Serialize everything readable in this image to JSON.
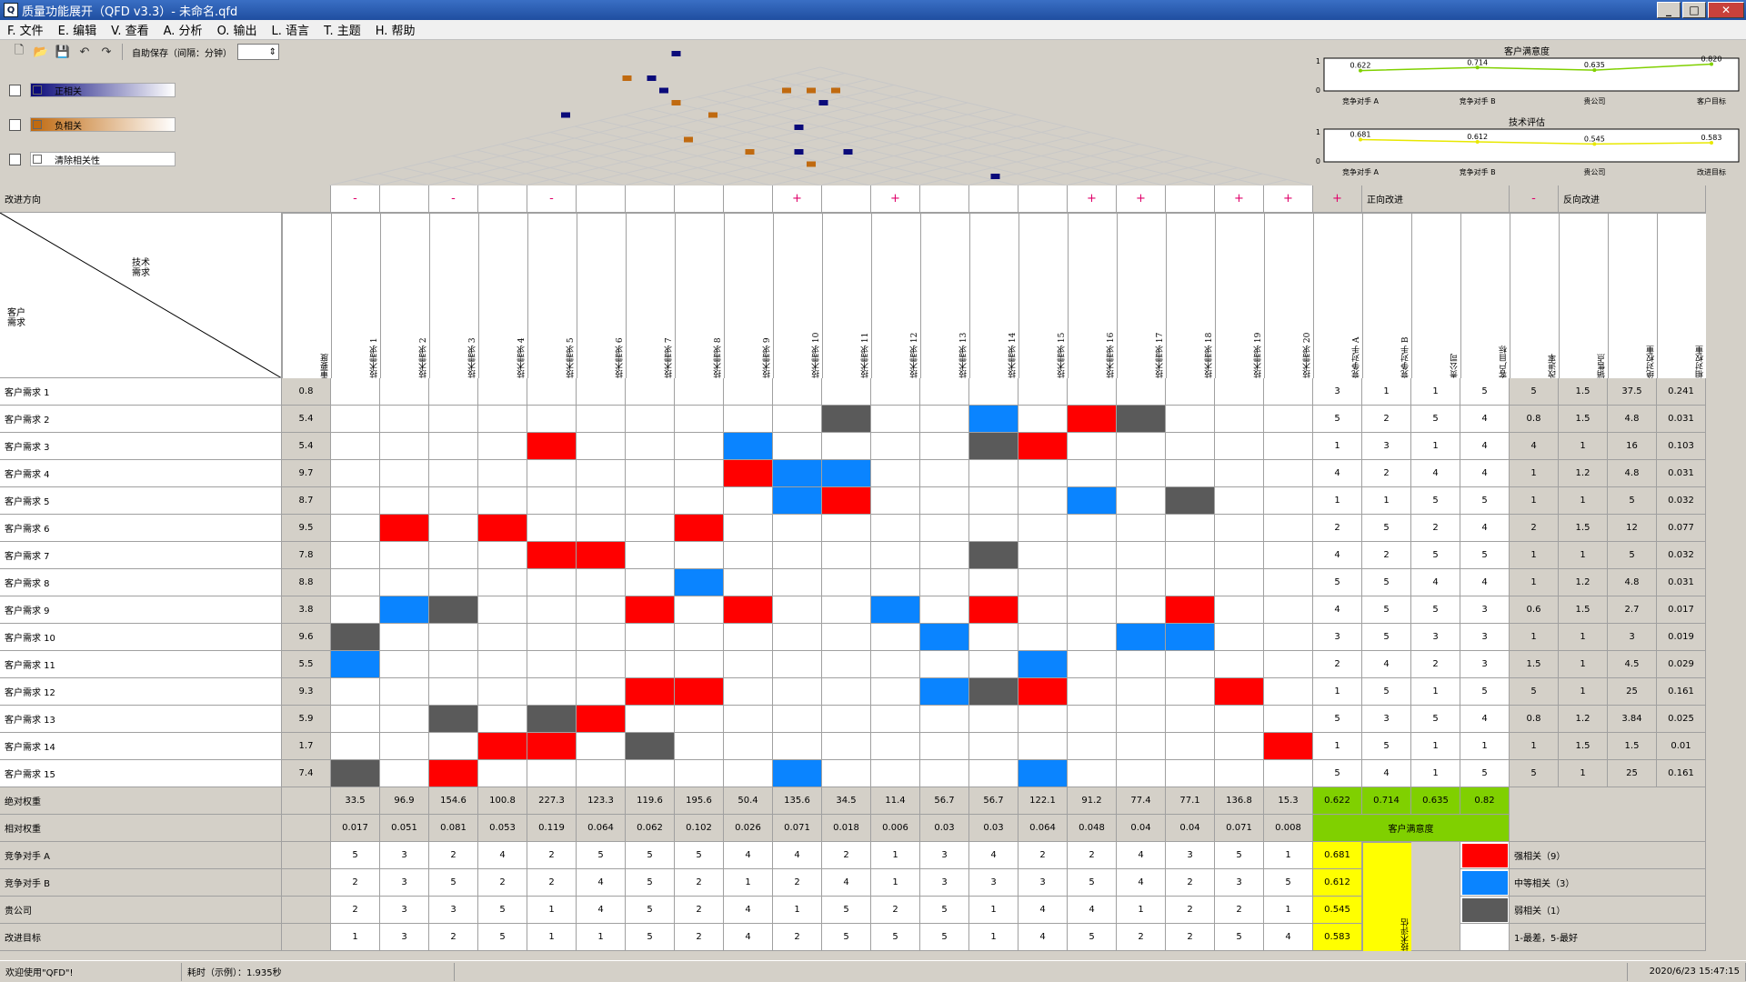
{
  "window": {
    "title": "质量功能展开（QFD  v3.3）- 未命名.qfd",
    "icon_glyph": "Q"
  },
  "menu": [
    "F. 文件",
    "E. 编辑",
    "V. 查看",
    "A. 分析",
    "O. 输出",
    "L. 语言",
    "T. 主题",
    "H. 帮助"
  ],
  "toolbar": {
    "autosave_label": "自助保存（间隔：分钟）",
    "autosave_value": ""
  },
  "legend_top": [
    {
      "label": "正相关",
      "color": "#0a0a7a"
    },
    {
      "label": "负相关",
      "color": "#c06a10"
    },
    {
      "label": "清除相关性",
      "color": "#ffffff"
    }
  ],
  "charts": {
    "customer": {
      "title": "客户满意度",
      "categories": [
        "竞争对手 A",
        "竞争对手 B",
        "贵公司",
        "客户目标"
      ],
      "values": [
        0.622,
        0.714,
        0.635,
        0.82
      ],
      "value_labels": [
        "0.622",
        "0.714",
        "0.635",
        "0.820"
      ],
      "ylim": [
        0,
        1
      ],
      "color": "#80d000",
      "ytick_max": "1",
      "ytick_min": "0"
    },
    "tech": {
      "title": "技术评估",
      "categories": [
        "竞争对手 A",
        "竞争对手 B",
        "贵公司",
        "改进目标"
      ],
      "values": [
        0.681,
        0.612,
        0.545,
        0.583
      ],
      "value_labels": [
        "0.681",
        "0.612",
        "0.545",
        "0.583"
      ],
      "ylim": [
        0,
        1
      ],
      "color": "#e8e800",
      "ytick_max": "1",
      "ytick_min": "0"
    }
  },
  "headers": {
    "improve_dir": "改进方向",
    "tech_req": "技术需求",
    "cust_req": "客户需求",
    "importance": "重要度",
    "pos_improve": "正向改进",
    "neg_improve": "反向改进",
    "abs_weight": "绝对权重",
    "rel_weight": "相对权重",
    "comp_a": "竞争对手 A",
    "comp_b": "竞争对手 B",
    "own": "贵公司",
    "target": "改进目标",
    "cust_sat": "客户满意度",
    "tech_eval": "技术评估",
    "right_cols": [
      "竞争对手 A",
      "竞争对手 B",
      "贵公司",
      "客户目标",
      "改进率",
      "销售点",
      "绝对权重",
      "相对权重"
    ]
  },
  "tech_labels": [
    "技术需求 1",
    "技术需求 2",
    "技术需求 3",
    "技术需求 4",
    "技术需求 5",
    "技术需求 6",
    "技术需求 7",
    "技术需求 8",
    "技术需求 9",
    "技术需求 10",
    "技术需求 11",
    "技术需求 12",
    "技术需求 13",
    "技术需求 14",
    "技术需求 15",
    "技术需求 16",
    "技术需求 17",
    "技术需求 18",
    "技术需求 19",
    "技术需求 20"
  ],
  "directions": [
    "-",
    "",
    "-",
    "",
    "-",
    "",
    "",
    "",
    "",
    "+",
    "",
    "+",
    "",
    "",
    "",
    "+",
    "+",
    "",
    "+",
    "+"
  ],
  "rows": [
    {
      "label": "客户需求 1",
      "imp": "0.8",
      "r": [
        "3",
        "1",
        "1",
        "5",
        "5",
        "1.5",
        "37.5",
        "0.241"
      ]
    },
    {
      "label": "客户需求 2",
      "imp": "5.4",
      "r": [
        "5",
        "2",
        "5",
        "4",
        "0.8",
        "1.5",
        "4.8",
        "0.031"
      ]
    },
    {
      "label": "客户需求 3",
      "imp": "5.4",
      "r": [
        "1",
        "3",
        "1",
        "4",
        "4",
        "1",
        "16",
        "0.103"
      ]
    },
    {
      "label": "客户需求 4",
      "imp": "9.7",
      "r": [
        "4",
        "2",
        "4",
        "4",
        "1",
        "1.2",
        "4.8",
        "0.031"
      ]
    },
    {
      "label": "客户需求 5",
      "imp": "8.7",
      "r": [
        "1",
        "1",
        "5",
        "5",
        "1",
        "1",
        "5",
        "0.032"
      ]
    },
    {
      "label": "客户需求 6",
      "imp": "9.5",
      "r": [
        "2",
        "5",
        "2",
        "4",
        "2",
        "1.5",
        "12",
        "0.077"
      ]
    },
    {
      "label": "客户需求 7",
      "imp": "7.8",
      "r": [
        "4",
        "2",
        "5",
        "5",
        "1",
        "1",
        "5",
        "0.032"
      ]
    },
    {
      "label": "客户需求 8",
      "imp": "8.8",
      "r": [
        "5",
        "5",
        "4",
        "4",
        "1",
        "1.2",
        "4.8",
        "0.031"
      ]
    },
    {
      "label": "客户需求 9",
      "imp": "3.8",
      "r": [
        "4",
        "5",
        "5",
        "3",
        "0.6",
        "1.5",
        "2.7",
        "0.017"
      ]
    },
    {
      "label": "客户需求 10",
      "imp": "9.6",
      "r": [
        "3",
        "5",
        "3",
        "3",
        "1",
        "1",
        "3",
        "0.019"
      ]
    },
    {
      "label": "客户需求 11",
      "imp": "5.5",
      "r": [
        "2",
        "4",
        "2",
        "3",
        "1.5",
        "1",
        "4.5",
        "0.029"
      ]
    },
    {
      "label": "客户需求 12",
      "imp": "9.3",
      "r": [
        "1",
        "5",
        "1",
        "5",
        "5",
        "1",
        "25",
        "0.161"
      ]
    },
    {
      "label": "客户需求 13",
      "imp": "5.9",
      "r": [
        "5",
        "3",
        "5",
        "4",
        "0.8",
        "1.2",
        "3.84",
        "0.025"
      ]
    },
    {
      "label": "客户需求 14",
      "imp": "1.7",
      "r": [
        "1",
        "5",
        "1",
        "1",
        "1",
        "1.5",
        "1.5",
        "0.01"
      ]
    },
    {
      "label": "客户需求 15",
      "imp": "7.4",
      "r": [
        "5",
        "4",
        "1",
        "5",
        "5",
        "1",
        "25",
        "0.161"
      ]
    }
  ],
  "matrix": {
    "strong": [
      [
        1,
        15
      ],
      [
        2,
        4
      ],
      [
        2,
        14
      ],
      [
        3,
        8
      ],
      [
        4,
        10
      ],
      [
        5,
        1
      ],
      [
        5,
        3
      ],
      [
        5,
        7
      ],
      [
        6,
        4
      ],
      [
        6,
        5
      ],
      [
        8,
        6
      ],
      [
        8,
        8
      ],
      [
        8,
        13
      ],
      [
        8,
        17
      ],
      [
        11,
        6
      ],
      [
        11,
        7
      ],
      [
        11,
        14
      ],
      [
        11,
        18
      ],
      [
        12,
        5
      ],
      [
        13,
        3
      ],
      [
        13,
        4
      ],
      [
        13,
        19
      ],
      [
        14,
        2
      ]
    ],
    "medium": [
      [
        1,
        13
      ],
      [
        2,
        8
      ],
      [
        3,
        9
      ],
      [
        3,
        10
      ],
      [
        4,
        9
      ],
      [
        4,
        15
      ],
      [
        7,
        7
      ],
      [
        8,
        1
      ],
      [
        8,
        11
      ],
      [
        9,
        12
      ],
      [
        9,
        16
      ],
      [
        9,
        17
      ],
      [
        10,
        0
      ],
      [
        10,
        14
      ],
      [
        11,
        12
      ],
      [
        14,
        9
      ],
      [
        14,
        14
      ]
    ],
    "weak": [
      [
        1,
        10
      ],
      [
        1,
        16
      ],
      [
        2,
        13
      ],
      [
        4,
        17
      ],
      [
        6,
        13
      ],
      [
        8,
        2
      ],
      [
        9,
        0
      ],
      [
        11,
        13
      ],
      [
        12,
        2
      ],
      [
        12,
        4
      ],
      [
        13,
        6
      ],
      [
        14,
        0
      ]
    ]
  },
  "abs_weight": [
    "33.5",
    "96.9",
    "154.6",
    "100.8",
    "227.3",
    "123.3",
    "119.6",
    "195.6",
    "50.4",
    "135.6",
    "34.5",
    "11.4",
    "56.7",
    "56.7",
    "122.1",
    "91.2",
    "77.4",
    "77.1",
    "136.8",
    "15.3"
  ],
  "rel_weight": [
    "0.017",
    "0.051",
    "0.081",
    "0.053",
    "0.119",
    "0.064",
    "0.062",
    "0.102",
    "0.026",
    "0.071",
    "0.018",
    "0.006",
    "0.03",
    "0.03",
    "0.064",
    "0.048",
    "0.04",
    "0.04",
    "0.071",
    "0.008"
  ],
  "comp_a": [
    "5",
    "3",
    "2",
    "4",
    "2",
    "5",
    "5",
    "5",
    "4",
    "4",
    "2",
    "1",
    "3",
    "4",
    "2",
    "2",
    "4",
    "3",
    "5",
    "1"
  ],
  "comp_b": [
    "2",
    "3",
    "5",
    "2",
    "2",
    "4",
    "5",
    "2",
    "1",
    "2",
    "4",
    "1",
    "3",
    "3",
    "3",
    "5",
    "4",
    "2",
    "3",
    "5"
  ],
  "own": [
    "2",
    "3",
    "3",
    "5",
    "1",
    "4",
    "5",
    "2",
    "4",
    "1",
    "5",
    "2",
    "5",
    "1",
    "4",
    "4",
    "1",
    "2",
    "2",
    "1"
  ],
  "target": [
    "1",
    "3",
    "2",
    "5",
    "1",
    "1",
    "5",
    "2",
    "4",
    "2",
    "5",
    "5",
    "5",
    "1",
    "4",
    "5",
    "2",
    "2",
    "5",
    "4"
  ],
  "cust_sat_values": [
    "0.622",
    "0.714",
    "0.635",
    "0.82"
  ],
  "tech_eval_values": [
    "0.681",
    "0.612",
    "0.545",
    "0.583"
  ],
  "legend_bottom": [
    {
      "label": "强相关（9）",
      "color": "#ff0000"
    },
    {
      "label": "中等相关（3）",
      "color": "#0a84ff"
    },
    {
      "label": "弱相关（1）",
      "color": "#5a5a5a"
    }
  ],
  "scale_note": "1-最差，5-最好",
  "roof_marks": [
    {
      "r": 0,
      "c": 9,
      "t": "n"
    },
    {
      "r": 2,
      "c": 6,
      "t": "p"
    },
    {
      "r": 2,
      "c": 7,
      "t": "n"
    },
    {
      "r": 3,
      "c": 7,
      "t": "n"
    },
    {
      "r": 3,
      "c": 12,
      "t": "p"
    },
    {
      "r": 3,
      "c": 13,
      "t": "p"
    },
    {
      "r": 3,
      "c": 14,
      "t": "p"
    },
    {
      "r": 4,
      "c": 7,
      "t": "p"
    },
    {
      "r": 4,
      "c": 13,
      "t": "n"
    },
    {
      "r": 5,
      "c": 2,
      "t": "n"
    },
    {
      "r": 5,
      "c": 8,
      "t": "p"
    },
    {
      "r": 6,
      "c": 11,
      "t": "n"
    },
    {
      "r": 7,
      "c": 6,
      "t": "p"
    },
    {
      "r": 8,
      "c": 8,
      "t": "p"
    },
    {
      "r": 8,
      "c": 10,
      "t": "n"
    },
    {
      "r": 8,
      "c": 12,
      "t": "n"
    },
    {
      "r": 9,
      "c": 10,
      "t": "p"
    },
    {
      "r": 10,
      "c": 17,
      "t": "n"
    }
  ],
  "status": {
    "left": "欢迎使用\"QFD\"!",
    "timing": "耗时（示例）：1.935秒",
    "datetime": "2020/6/23  15:47:15"
  }
}
